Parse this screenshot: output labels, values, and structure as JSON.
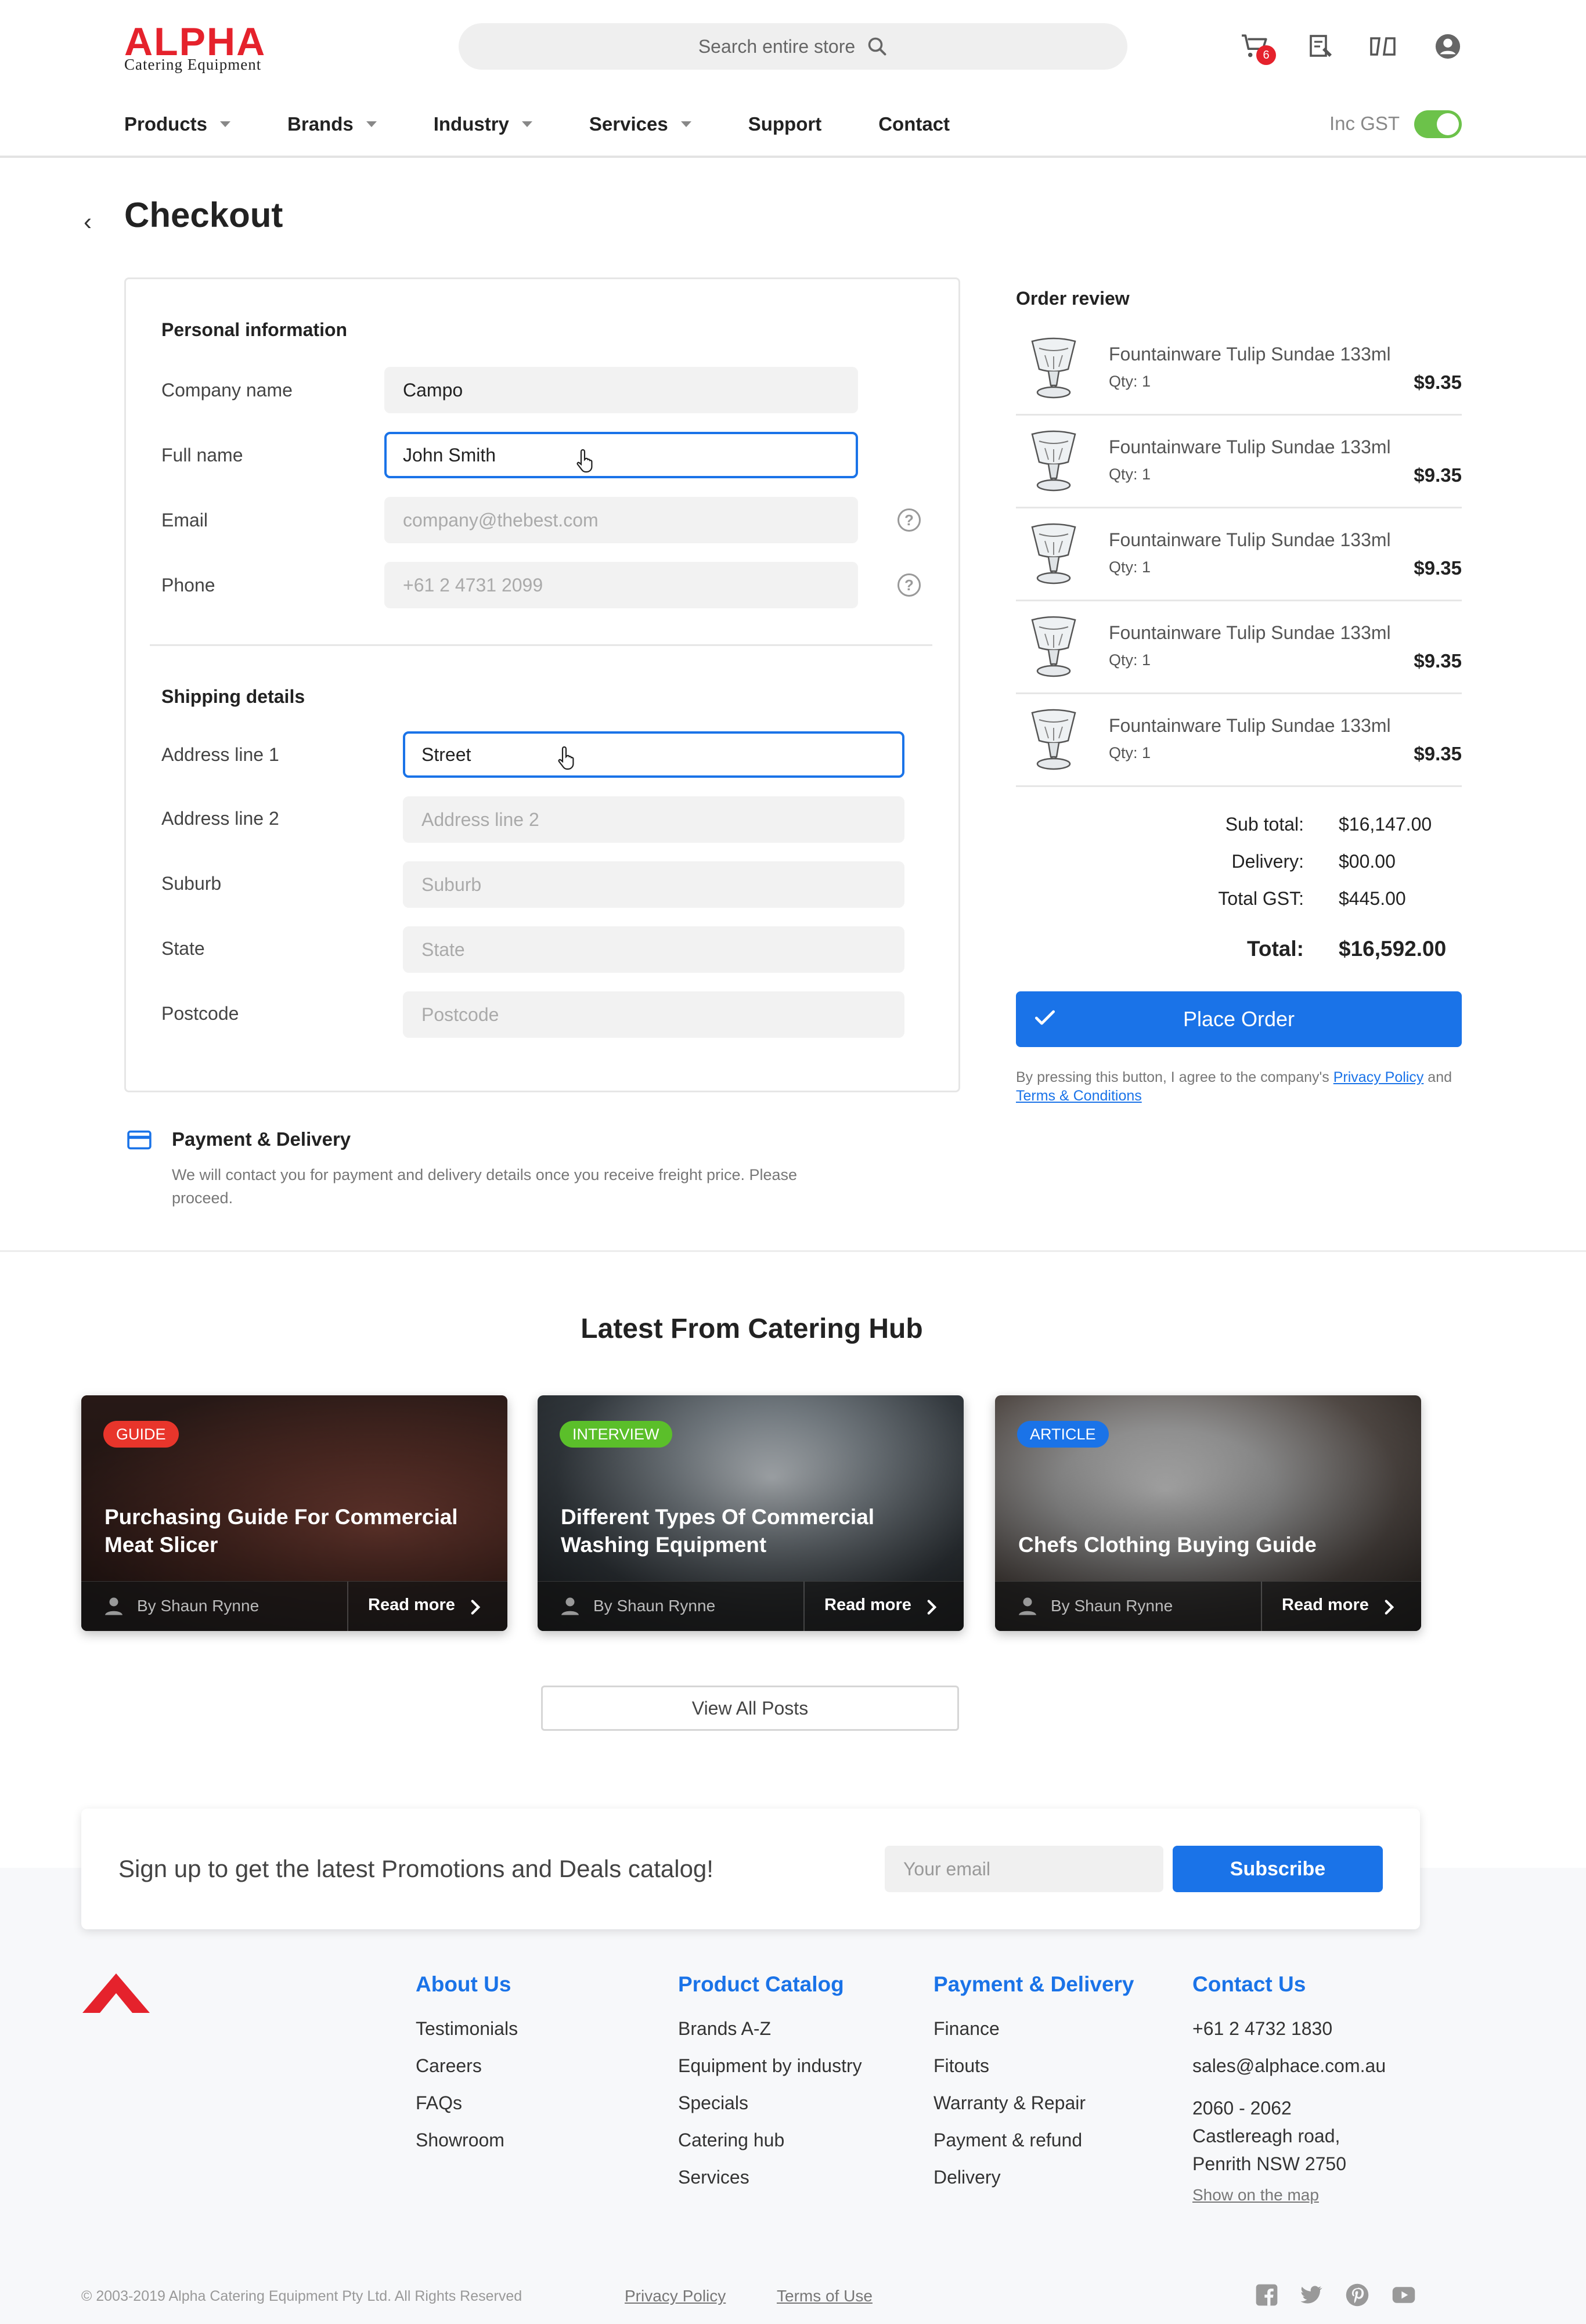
{
  "header": {
    "logo_word": "ALPHA",
    "logo_sub": "Catering Equipment",
    "search_placeholder": "Search entire store",
    "cart_count": "6",
    "nav": [
      "Products",
      "Brands",
      "Industry",
      "Services",
      "Support",
      "Contact"
    ],
    "gst_label": "Inc GST",
    "gst_on": true
  },
  "checkout": {
    "title": "Checkout",
    "personal": {
      "heading": "Personal information",
      "company_label": "Company name",
      "company_value": "Campo",
      "fullname_label": "Full name",
      "fullname_value": "John Smith",
      "email_label": "Email",
      "email_placeholder": "company@thebest.com",
      "phone_label": "Phone",
      "phone_placeholder": "+61 2 4731 2099"
    },
    "shipping": {
      "heading": "Shipping details",
      "address1_label": "Address line 1",
      "address1_value": "Street",
      "address2_label": "Address line 2",
      "address2_placeholder": "Address line 2",
      "suburb_label": "Suburb",
      "suburb_placeholder": "Suburb",
      "state_label": "State",
      "state_placeholder": "State",
      "postcode_label": "Postcode",
      "postcode_placeholder": "Postcode"
    },
    "payment": {
      "title": "Payment & Delivery",
      "text": "We will contact you for payment and delivery details once you receive freight price. Please proceed."
    }
  },
  "order": {
    "heading": "Order review",
    "items": [
      {
        "name": "Fountainware Tulip Sundae 133ml",
        "qty": "Qty: 1",
        "price": "$9.35"
      },
      {
        "name": "Fountainware Tulip Sundae 133ml",
        "qty": "Qty: 1",
        "price": "$9.35"
      },
      {
        "name": "Fountainware Tulip Sundae 133ml",
        "qty": "Qty: 1",
        "price": "$9.35"
      },
      {
        "name": "Fountainware Tulip Sundae 133ml",
        "qty": "Qty: 1",
        "price": "$9.35"
      },
      {
        "name": "Fountainware Tulip Sundae 133ml",
        "qty": "Qty: 1",
        "price": "$9.35"
      }
    ],
    "subtotal_label": "Sub total:",
    "subtotal": "$16,147.00",
    "delivery_label": "Delivery:",
    "delivery": "$00.00",
    "gst_label": "Total GST:",
    "gst": "$445.00",
    "total_label": "Total:",
    "total": "$16,592.00",
    "place_order": "Place Order",
    "legal_pre": "By pressing this button, I agree to the company's",
    "privacy": "Privacy Policy",
    "and": "and",
    "terms": "Terms & Conditions"
  },
  "hub": {
    "heading": "Latest From Catering Hub",
    "cards": [
      {
        "tag": "GUIDE",
        "tag_color": "#e8352b",
        "title": "Purchasing Guide For Commercial Meat Slicer",
        "author": "By Shaun Rynne",
        "read": "Read more"
      },
      {
        "tag": "INTERVIEW",
        "tag_color": "#5bbf2a",
        "title": "Different Types Of Commercial Washing Equipment",
        "author": "By Shaun Rynne",
        "read": "Read more"
      },
      {
        "tag": "ARTICLE",
        "tag_color": "#1a73e8",
        "title": "Chefs Clothing Buying Guide",
        "author": "By Shaun Rynne",
        "read": "Read more"
      }
    ],
    "view_all": "View All Posts"
  },
  "newsletter": {
    "text": "Sign up to get the latest Promotions and Deals catalog!",
    "email_placeholder": "Your email",
    "subscribe": "Subscribe"
  },
  "footer": {
    "about": {
      "heading": "About Us",
      "links": [
        "Testimonials",
        "Careers",
        "FAQs",
        "Showroom"
      ]
    },
    "catalog": {
      "heading": "Product Catalog",
      "links": [
        "Brands A-Z",
        "Equipment by industry",
        "Specials",
        "Catering hub",
        "Services"
      ]
    },
    "payment": {
      "heading": "Payment & Delivery",
      "links": [
        "Finance",
        "Fitouts",
        "Warranty & Repair",
        "Payment & refund",
        "Delivery"
      ]
    },
    "contact": {
      "heading": "Contact Us",
      "phone": "+61 2 4732 1830",
      "email": "sales@alphace.com.au",
      "addr1": "2060 - 2062",
      "addr2": "Castlereagh road,",
      "addr3": "Penrith NSW 2750",
      "map": "Show on the map"
    },
    "copyright": "© 2003-2019 Alpha Catering Equipment Pty Ltd. All Rights Reserved",
    "privacy": "Privacy Policy",
    "terms": "Terms of Use"
  },
  "colors": {
    "accent": "#1a73e8",
    "brand": "#e5222c",
    "toggle": "#6cc24a"
  }
}
